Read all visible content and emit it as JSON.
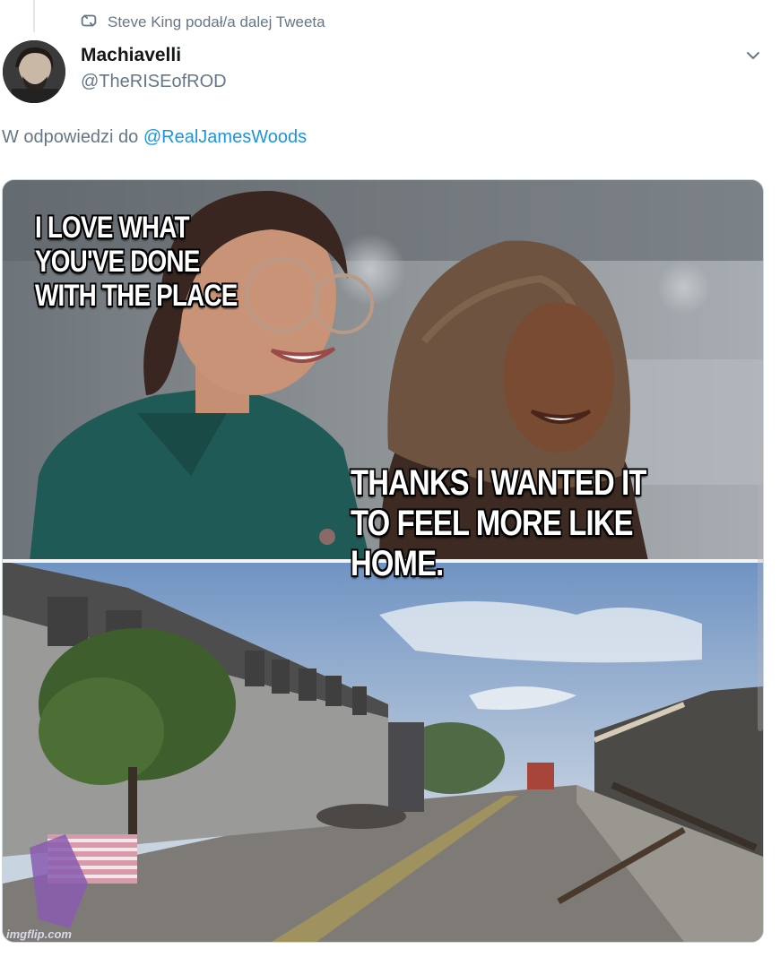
{
  "retweet": {
    "text": "Steve King podał/a dalej Tweeta",
    "icon": "retweet-icon"
  },
  "author": {
    "name": "Machiavelli",
    "handle": "@TheRISEofROD"
  },
  "reply": {
    "prefix": "W odpowiedzi do ",
    "mention": "@RealJamesWoods"
  },
  "media": {
    "caption_left": "I LOVE WHAT\nYOU'VE DONE\nWITH THE PLACE",
    "caption_right": "THANKS I WANTED IT\nTO FEEL MORE LIKE HOME.",
    "watermark": "imgflip.com"
  },
  "colors": {
    "link": "#1b95e0",
    "muted": "#657786",
    "text": "#14171a"
  }
}
